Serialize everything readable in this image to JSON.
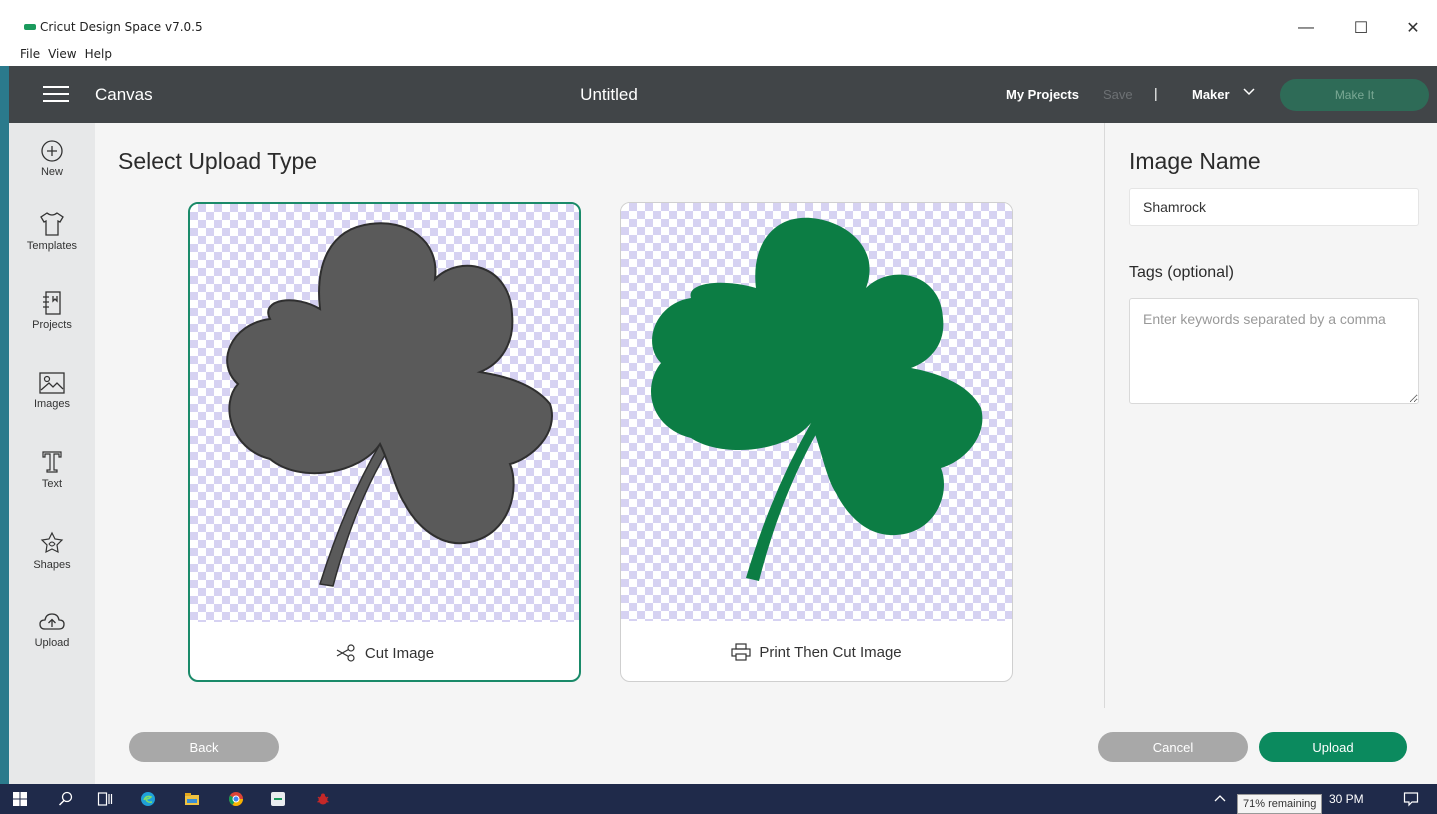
{
  "window": {
    "title": "Cricut Design Space  v7.0.5",
    "menu": [
      "File",
      "View",
      "Help"
    ],
    "controls": {
      "minimize": "—",
      "maximize": "☐",
      "close": "✕"
    }
  },
  "header": {
    "section": "Canvas",
    "project_title": "Untitled",
    "my_projects": "My Projects",
    "save": "Save",
    "separator": "|",
    "machine": "Maker",
    "make_it": "Make It"
  },
  "sidebar": {
    "items": [
      {
        "label": "New",
        "icon": "plus-circle-icon"
      },
      {
        "label": "Templates",
        "icon": "tshirt-icon"
      },
      {
        "label": "Projects",
        "icon": "projects-icon"
      },
      {
        "label": "Images",
        "icon": "image-icon"
      },
      {
        "label": "Text",
        "icon": "text-icon"
      },
      {
        "label": "Shapes",
        "icon": "shapes-icon"
      },
      {
        "label": "Upload",
        "icon": "cloud-upload-icon"
      }
    ]
  },
  "main": {
    "title": "Select Upload Type",
    "options": [
      {
        "label": "Cut Image",
        "icon": "scissors-icon",
        "selected": true,
        "fill": "#5a5a5a"
      },
      {
        "label": "Print Then Cut Image",
        "icon": "printer-icon",
        "selected": false,
        "fill": "#0c7d44"
      }
    ]
  },
  "footer": {
    "back": "Back",
    "cancel": "Cancel",
    "upload": "Upload"
  },
  "details": {
    "image_name_label": "Image Name",
    "image_name_value": "Shamrock",
    "tags_label": "Tags (optional)",
    "tags_placeholder": "Enter keywords separated by a comma"
  },
  "taskbar": {
    "tooltip": "71% remaining",
    "time": "30 PM"
  },
  "colors": {
    "accent_green": "#0b8a5e",
    "header_bg": "#414548",
    "sidebar_bg": "#e7e8e9",
    "checker": "#d6d2f2"
  }
}
